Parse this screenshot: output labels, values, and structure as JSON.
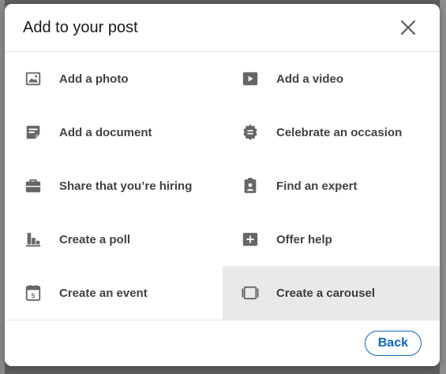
{
  "modal": {
    "title": "Add to your post",
    "close_icon": "close-icon",
    "back_label": "Back",
    "accent": "#0a66c2",
    "icon_color": "#666666",
    "selected_bg": "#e9e9e9"
  },
  "items": [
    {
      "label": "Add a photo",
      "icon": "image-icon"
    },
    {
      "label": "Add a video",
      "icon": "video-icon"
    },
    {
      "label": "Add a document",
      "icon": "document-icon"
    },
    {
      "label": "Celebrate an occasion",
      "icon": "celebrate-badge-icon"
    },
    {
      "label": "Share that you’re hiring",
      "icon": "briefcase-icon"
    },
    {
      "label": "Find an expert",
      "icon": "clipboard-person-icon"
    },
    {
      "label": "Create a poll",
      "icon": "bar-chart-icon"
    },
    {
      "label": "Offer help",
      "icon": "plus-box-icon"
    },
    {
      "label": "Create an event",
      "icon": "calendar-icon"
    },
    {
      "label": "Create a carousel",
      "icon": "carousel-icon",
      "selected": true
    }
  ]
}
